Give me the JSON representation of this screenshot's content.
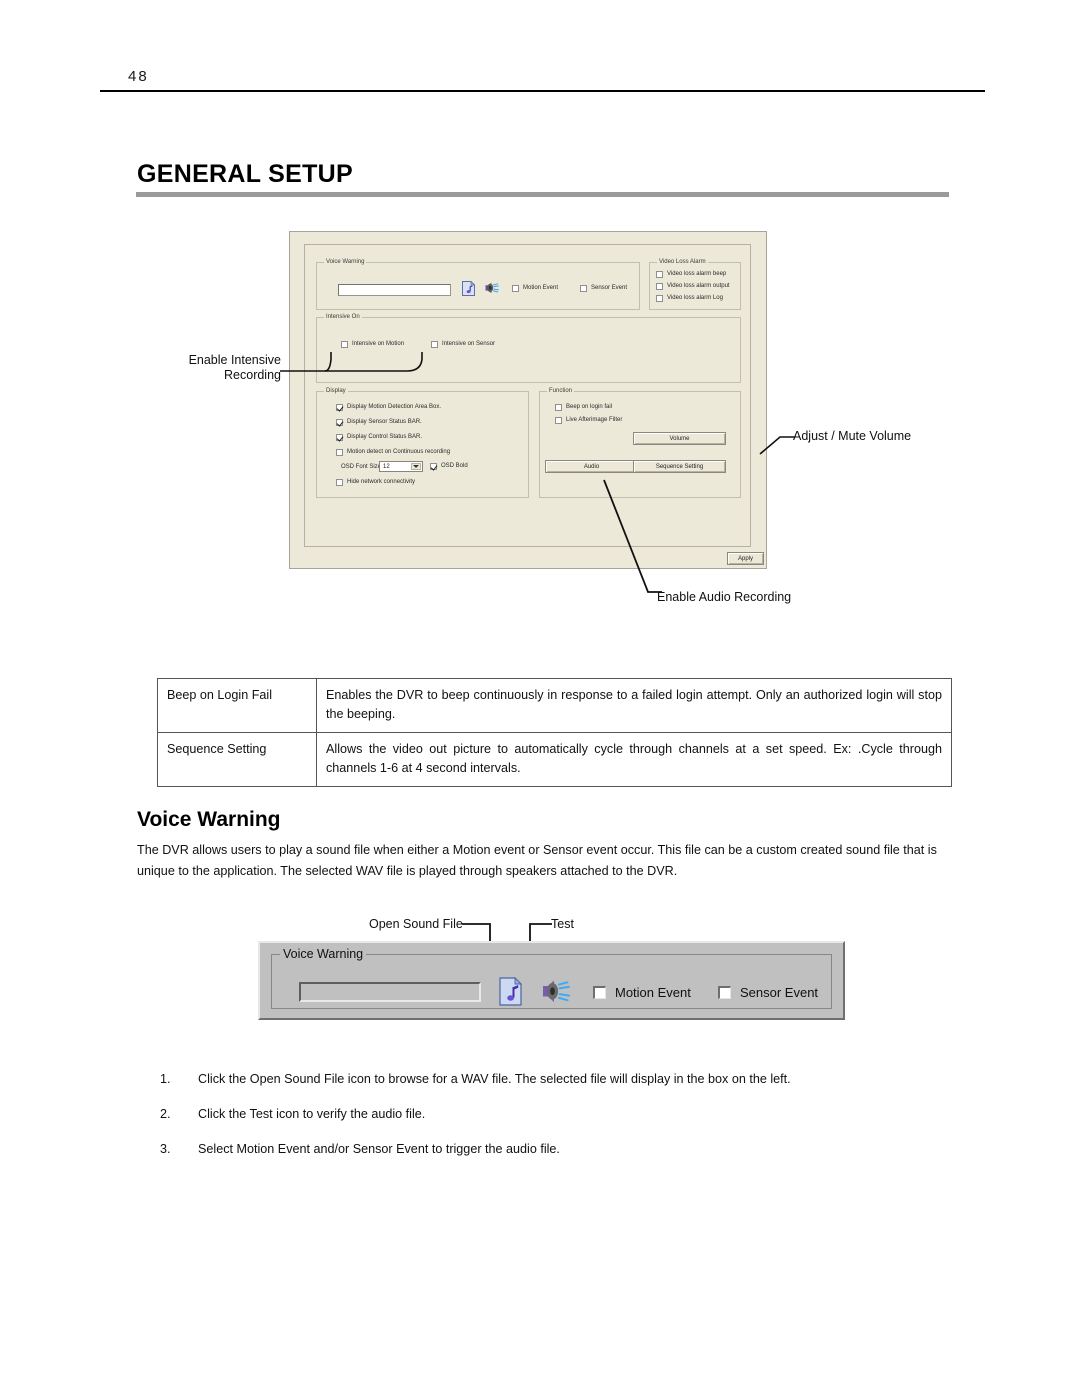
{
  "page": {
    "number": "48",
    "title": "GENERAL SETUP"
  },
  "dvr_dialog": {
    "voice_warning": {
      "group_title": "Voice Warning",
      "file_value": "",
      "open_sound_file_icon": "music-file-icon",
      "test_icon": "speaker-icon",
      "checkboxes": [
        {
          "label": "Motion Event",
          "checked": false
        },
        {
          "label": "Sensor Event",
          "checked": false
        }
      ]
    },
    "video_loss_alarm": {
      "group_title": "Video Loss Alarm",
      "checkboxes": [
        {
          "label": "Video loss alarm beep",
          "checked": false
        },
        {
          "label": "Video loss alarm output",
          "checked": false
        },
        {
          "label": "Video loss alarm Log",
          "checked": false
        }
      ]
    },
    "intensive_on": {
      "group_title": "Intensive On",
      "checkboxes": [
        {
          "label": "Intensive on Motion",
          "checked": false
        },
        {
          "label": "Intensive on Sensor",
          "checked": false
        }
      ]
    },
    "display": {
      "group_title": "Display",
      "checkboxes": [
        {
          "label": "Display Motion Detection Area Box.",
          "checked": true
        },
        {
          "label": "Display Sensor Status BAR.",
          "checked": true
        },
        {
          "label": "Display Control Status BAR.",
          "checked": true
        },
        {
          "label": "Motion detect on Continuous recording",
          "checked": false
        }
      ],
      "osd_font_size_label": "OSD Font Size :",
      "osd_font_size_value": "12",
      "osd_bold_label": "OSD Bold",
      "osd_bold_checked": true,
      "hide_network_label": "Hide network connectivity",
      "hide_network_checked": false
    },
    "function": {
      "group_title": "Function",
      "checkboxes": [
        {
          "label": "Beep on login fail",
          "checked": false
        },
        {
          "label": "Live Afterimage Filter",
          "checked": false
        }
      ],
      "volume_button": "Volume",
      "audio_button": "Audio",
      "sequence_button": "Sequence Setting"
    },
    "apply_button": "Apply"
  },
  "callouts": {
    "enable_intensive_recording": "Enable Intensive\nRecording",
    "enable_intensive_recording_line1": "Enable Intensive",
    "enable_intensive_recording_line2": "Recording",
    "adjust_mute_volume": "Adjust / Mute Volume",
    "enable_audio_recording": "Enable Audio Recording",
    "open_sound_file": "Open Sound File",
    "test": "Test"
  },
  "description_table": {
    "rows": [
      {
        "term": "Beep on Login Fail",
        "definition": "Enables the DVR to beep continuously in response to a failed login attempt.  Only an authorized login will stop the beeping."
      },
      {
        "term": "Sequence Setting",
        "definition": "Allows the video out picture to automatically cycle through channels at a set speed.   Ex: .Cycle through channels 1-6 at 4 second intervals."
      }
    ]
  },
  "voice_warning_section": {
    "heading": "Voice Warning",
    "body": "The DVR allows users to play a sound file when either a Motion event or Sensor event occur. This file can be a custom created sound file that is unique to the application. The selected WAV file is played through speakers attached to the DVR.",
    "panel": {
      "group_title": "Voice Warning",
      "file_value": "",
      "checkboxes": [
        {
          "label": "Motion Event",
          "checked": false
        },
        {
          "label": "Sensor Event",
          "checked": false
        }
      ]
    },
    "steps": [
      {
        "num": "1.",
        "text": "Click the Open Sound File icon to browse for a WAV file.  The selected file will display in the box on the left."
      },
      {
        "num": "2.",
        "text": "Click the Test icon to verify the audio file."
      },
      {
        "num": "3.",
        "text": "Select Motion Event and/or Sensor Event to trigger the audio file."
      }
    ]
  },
  "colors": {
    "dialog_background": "#ece9d8",
    "panel_background": "#c0c0c0",
    "title_rule": "#9a9a9a",
    "text": "#111111"
  }
}
